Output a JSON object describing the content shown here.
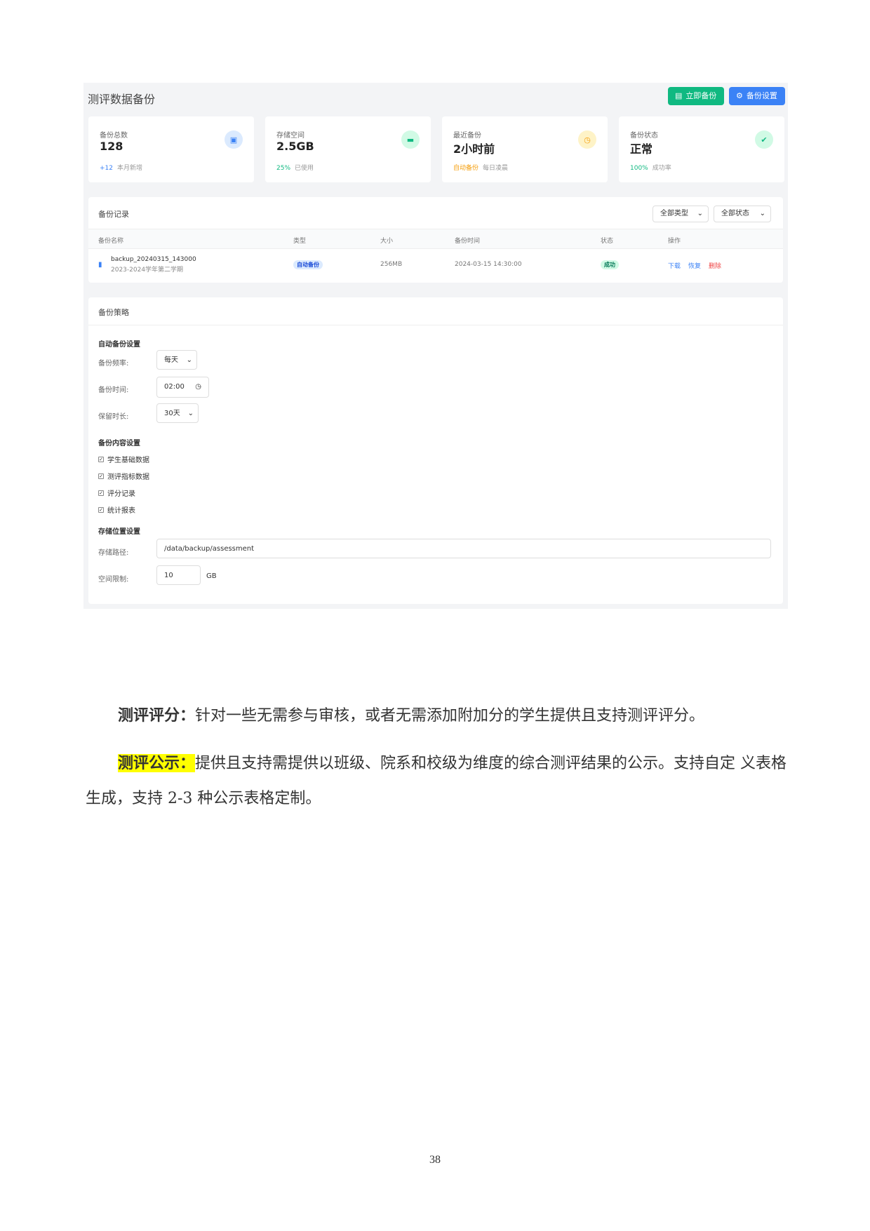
{
  "panel": {
    "title": "测评数据备份",
    "backup_now": "立即备份",
    "backup_settings": "备份设置"
  },
  "stats": [
    {
      "label": "备份总数",
      "value": "128",
      "highlight": "+12",
      "note": "本月新增",
      "color": "#3b82f6",
      "icon": "save-icon"
    },
    {
      "label": "存储空间",
      "value": "2.5GB",
      "highlight": "25%",
      "note": "已使用",
      "color": "#10b981",
      "icon": "storage-icon"
    },
    {
      "label": "最近备份",
      "value": "2小时前",
      "highlight": "自动备份",
      "note": "每日凌晨",
      "color": "#f59e0b",
      "icon": "clock-icon"
    },
    {
      "label": "备份状态",
      "value": "正常",
      "highlight": "100%",
      "note": "成功率",
      "color": "#10b981",
      "icon": "check-circle-icon"
    }
  ],
  "records": {
    "title": "备份记录",
    "filter_type": "全部类型",
    "filter_status": "全部状态",
    "columns": [
      "备份名称",
      "类型",
      "大小",
      "备份时间",
      "状态",
      "操作"
    ],
    "rows": [
      {
        "name": "backup_20240315_143000",
        "term": "2023-2024学年第二学期",
        "type": "自动备份",
        "size": "256MB",
        "time": "2024-03-15 14:30:00",
        "status": "成功",
        "actions": [
          "下载",
          "恢复",
          "删除"
        ]
      }
    ]
  },
  "strategy": {
    "title": "备份策略",
    "auto_section": "自动备份设置",
    "freq_label": "备份频率:",
    "freq_value": "每天",
    "time_label": "备份时间:",
    "time_value": "02:00",
    "retain_label": "保留时长:",
    "retain_value": "30天",
    "content_section": "备份内容设置",
    "content_items": [
      "学生基础数据",
      "测评指标数据",
      "评分记录",
      "统计报表"
    ],
    "storage_section": "存储位置设置",
    "path_label": "存储路径:",
    "path_value": "/data/backup/assessment",
    "limit_label": "空间限制:",
    "limit_value": "10",
    "limit_unit": "GB"
  },
  "doc": {
    "p1_head": "测评评分：",
    "p1_body": "针对一些无需参与审核，或者无需添加附加分的学生提供且支持测评评分。",
    "p2_head": "测评公示：",
    "p2_body": "提供且支持需提供以班级、院系和校级为维度的综合测评结果的公示。支持自定 义表格生成，支持 2-3  种公示表格定制。",
    "page_number": "38"
  }
}
